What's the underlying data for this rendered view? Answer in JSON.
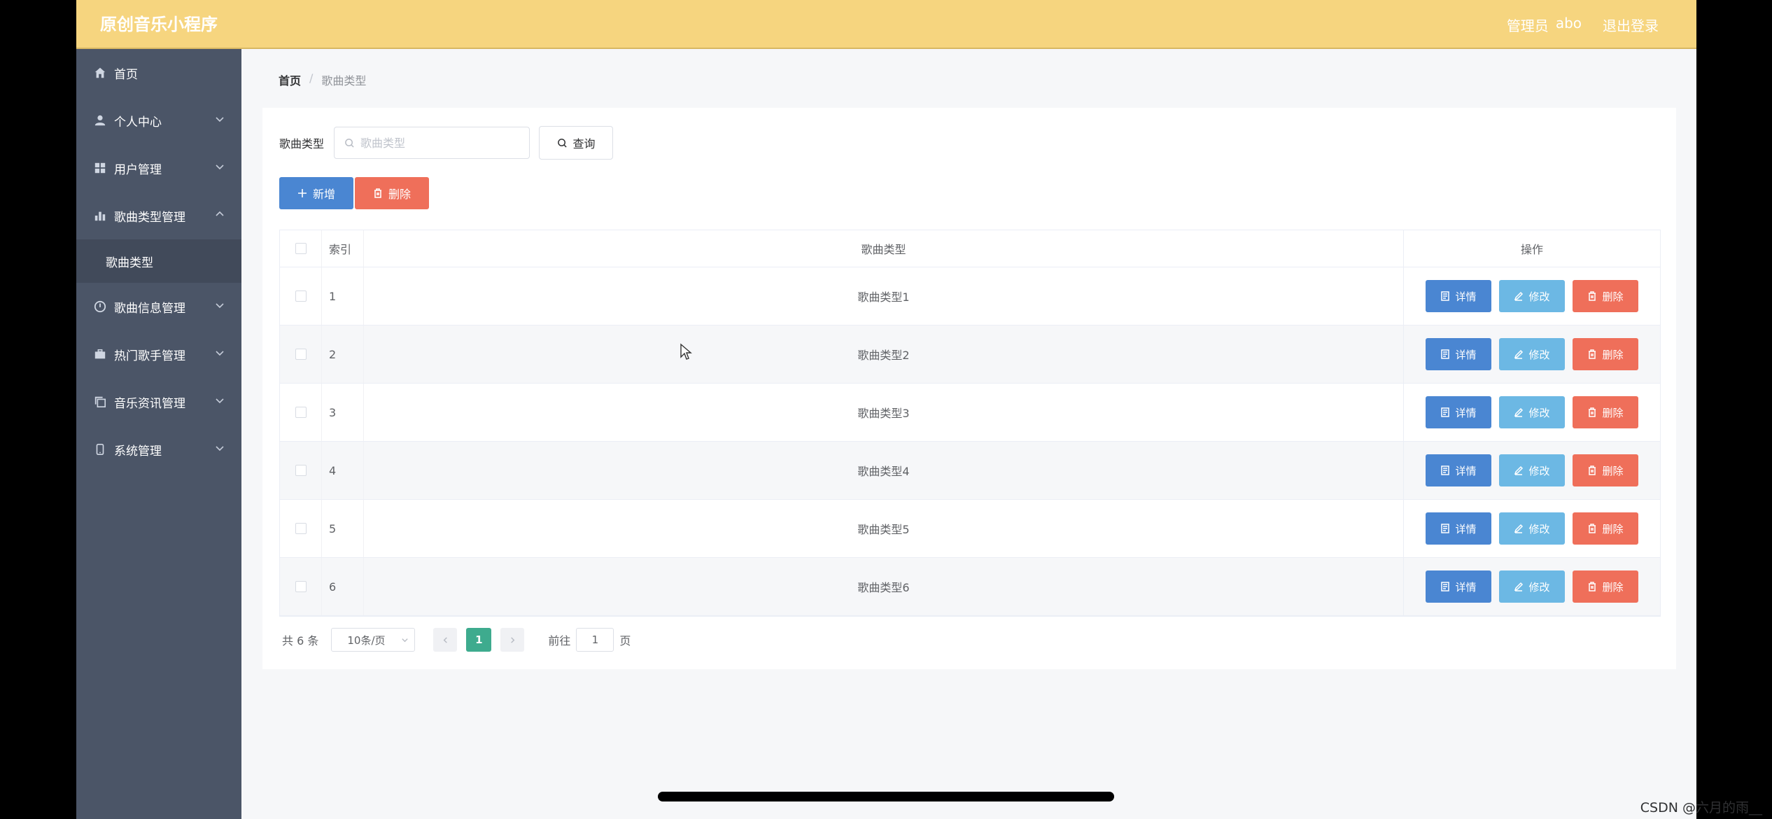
{
  "header": {
    "app_title": "原创音乐小程序",
    "user_label": "管理员",
    "user_name": "abo",
    "logout": "退出登录"
  },
  "sidebar": {
    "items": [
      {
        "label": "首页",
        "icon": "home-icon"
      },
      {
        "label": "个人中心",
        "icon": "user-icon"
      },
      {
        "label": "用户管理",
        "icon": "grid-icon"
      },
      {
        "label": "歌曲类型管理",
        "icon": "bar-chart-icon",
        "expanded": true
      },
      {
        "label": "歌曲信息管理",
        "icon": "disc-icon"
      },
      {
        "label": "热门歌手管理",
        "icon": "briefcase-icon"
      },
      {
        "label": "音乐资讯管理",
        "icon": "copy-icon"
      },
      {
        "label": "系统管理",
        "icon": "phone-icon"
      }
    ],
    "subitem": "歌曲类型"
  },
  "breadcrumb": {
    "home": "首页",
    "separator": "/",
    "current": "歌曲类型"
  },
  "search": {
    "label": "歌曲类型",
    "placeholder": "歌曲类型",
    "button": "查询"
  },
  "actions": {
    "add": "新增",
    "delete": "删除"
  },
  "table": {
    "headers": {
      "index": "索引",
      "type": "歌曲类型",
      "ops": "操作"
    },
    "rows": [
      {
        "index": "1",
        "type": "歌曲类型1"
      },
      {
        "index": "2",
        "type": "歌曲类型2"
      },
      {
        "index": "3",
        "type": "歌曲类型3"
      },
      {
        "index": "4",
        "type": "歌曲类型4"
      },
      {
        "index": "5",
        "type": "歌曲类型5"
      },
      {
        "index": "6",
        "type": "歌曲类型6"
      }
    ],
    "row_buttons": {
      "detail": "详情",
      "edit": "修改",
      "delete": "删除"
    }
  },
  "pagination": {
    "total": "共 6 条",
    "page_size": "10条/页",
    "current_page": "1",
    "goto_label": "前往",
    "goto_value": "1",
    "page_unit": "页"
  },
  "watermark": "CSDN @六月的雨__",
  "colors": {
    "header_bg": "#f6d57f",
    "sidebar_bg": "#4b5567",
    "primary": "#4a86d2",
    "edit": "#6cb8e4",
    "danger": "#ef6f5a",
    "active_page": "#3eab8e"
  }
}
